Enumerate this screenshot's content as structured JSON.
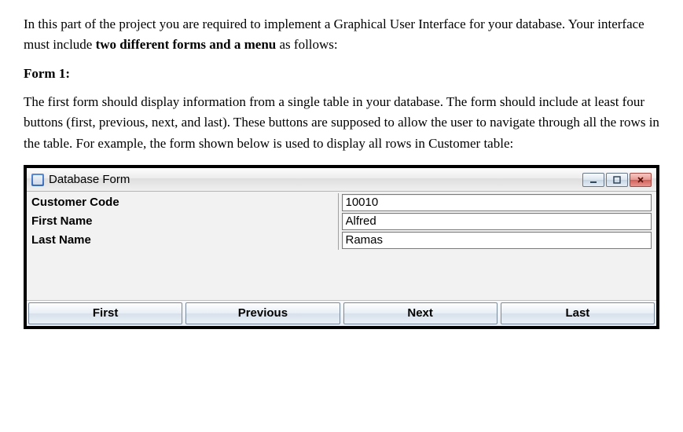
{
  "instructions": {
    "intro_prefix": "In this part of the project you are required to implement a Graphical User Interface for your database. Your interface must include ",
    "intro_bold": "two different forms and a menu",
    "intro_suffix": " as follows:",
    "form1_heading": "Form 1:",
    "form1_body": "The first form should display information from a single table in your database. The form should include at least four buttons (first, previous, next, and last). These buttons are supposed to allow the user to navigate through all the rows in the table. For example, the form shown below is used to display all rows in Customer table:"
  },
  "window": {
    "title": "Database Form",
    "fields": [
      {
        "label": "Customer Code",
        "value": "10010"
      },
      {
        "label": "First Name",
        "value": "Alfred"
      },
      {
        "label": "Last Name",
        "value": "Ramas"
      }
    ],
    "buttons": {
      "first": "First",
      "previous": "Previous",
      "next": "Next",
      "last": "Last"
    }
  }
}
